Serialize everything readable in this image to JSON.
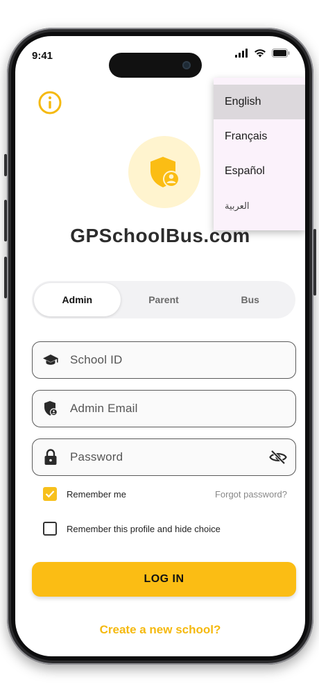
{
  "status": {
    "time": "9:41"
  },
  "app": {
    "title": "GPSchoolBus.com"
  },
  "tabs": [
    {
      "label": "Admin",
      "active": true
    },
    {
      "label": "Parent",
      "active": false
    },
    {
      "label": "Bus",
      "active": false
    }
  ],
  "fields": {
    "school_id": {
      "placeholder": "School ID",
      "icon": "graduation-cap-icon"
    },
    "admin_email": {
      "placeholder": "Admin Email",
      "icon": "shield-user-icon"
    },
    "password": {
      "placeholder": "Password",
      "icon": "lock-icon",
      "toggle_icon": "eye-off-icon"
    }
  },
  "options": {
    "remember_me": {
      "label": "Remember me",
      "checked": true
    },
    "forgot_password": "Forgot password?",
    "remember_profile": {
      "label": "Remember this profile and hide choice",
      "checked": false
    }
  },
  "actions": {
    "login_label": "LOG IN",
    "create_school": "Create a new school?"
  },
  "language_menu": {
    "items": [
      "English",
      "Français",
      "Español",
      "العربية"
    ],
    "selected": "English"
  },
  "colors": {
    "accent": "#fbbd14",
    "accent_light": "#fff4cf",
    "menu_bg": "#fbf2fb",
    "menu_selected": "#dcd8dc"
  }
}
